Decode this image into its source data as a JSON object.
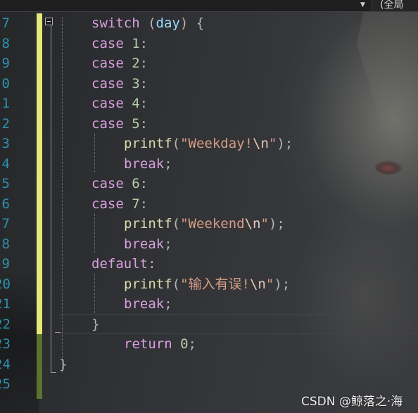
{
  "toolbar": {
    "scope_label": "(全局"
  },
  "editor": {
    "line_numbers": [
      "7",
      "8",
      "9",
      "0",
      "1",
      "2",
      "3",
      "4",
      "5",
      "6",
      "7",
      "8",
      "9",
      "20",
      "21",
      "22",
      "23",
      "24",
      "25"
    ],
    "lines": [
      [
        {
          "t": "switch",
          "c": "kw"
        },
        {
          "t": " (",
          "c": "punct"
        },
        {
          "t": "day",
          "c": "var"
        },
        {
          "t": ") {",
          "c": "punct"
        }
      ],
      [
        {
          "t": "case",
          "c": "kw"
        },
        {
          "t": " ",
          "c": "punct"
        },
        {
          "t": "1",
          "c": "num"
        },
        {
          "t": ":",
          "c": "punct"
        }
      ],
      [
        {
          "t": "case",
          "c": "kw"
        },
        {
          "t": " ",
          "c": "punct"
        },
        {
          "t": "2",
          "c": "num"
        },
        {
          "t": ":",
          "c": "punct"
        }
      ],
      [
        {
          "t": "case",
          "c": "kw"
        },
        {
          "t": " ",
          "c": "punct"
        },
        {
          "t": "3",
          "c": "num"
        },
        {
          "t": ":",
          "c": "punct"
        }
      ],
      [
        {
          "t": "case",
          "c": "kw"
        },
        {
          "t": " ",
          "c": "punct"
        },
        {
          "t": "4",
          "c": "num"
        },
        {
          "t": ":",
          "c": "punct"
        }
      ],
      [
        {
          "t": "case",
          "c": "kw"
        },
        {
          "t": " ",
          "c": "punct"
        },
        {
          "t": "5",
          "c": "num"
        },
        {
          "t": ":",
          "c": "punct"
        }
      ],
      [
        {
          "t": "printf",
          "c": "fn"
        },
        {
          "t": "(",
          "c": "punct"
        },
        {
          "t": "\"Weekday!",
          "c": "str"
        },
        {
          "t": "\\n",
          "c": "esc"
        },
        {
          "t": "\"",
          "c": "str"
        },
        {
          "t": ");",
          "c": "punct"
        }
      ],
      [
        {
          "t": "break",
          "c": "kw"
        },
        {
          "t": ";",
          "c": "punct"
        }
      ],
      [
        {
          "t": "case",
          "c": "kw"
        },
        {
          "t": " ",
          "c": "punct"
        },
        {
          "t": "6",
          "c": "num"
        },
        {
          "t": ":",
          "c": "punct"
        }
      ],
      [
        {
          "t": "case",
          "c": "kw"
        },
        {
          "t": " ",
          "c": "punct"
        },
        {
          "t": "7",
          "c": "num"
        },
        {
          "t": ":",
          "c": "punct"
        }
      ],
      [
        {
          "t": "printf",
          "c": "fn"
        },
        {
          "t": "(",
          "c": "punct"
        },
        {
          "t": "\"Weekend",
          "c": "str"
        },
        {
          "t": "\\n",
          "c": "esc"
        },
        {
          "t": "\"",
          "c": "str"
        },
        {
          "t": ");",
          "c": "punct"
        }
      ],
      [
        {
          "t": "break",
          "c": "kw"
        },
        {
          "t": ";",
          "c": "punct"
        }
      ],
      [
        {
          "t": "default",
          "c": "kw"
        },
        {
          "t": ":",
          "c": "punct"
        }
      ],
      [
        {
          "t": "printf",
          "c": "fn"
        },
        {
          "t": "(",
          "c": "punct"
        },
        {
          "t": "\"输入有误!",
          "c": "str"
        },
        {
          "t": "\\n",
          "c": "esc"
        },
        {
          "t": "\"",
          "c": "str"
        },
        {
          "t": ");",
          "c": "punct"
        }
      ],
      [
        {
          "t": "break",
          "c": "kw"
        },
        {
          "t": ";",
          "c": "punct"
        }
      ],
      [
        {
          "t": "}",
          "c": "punct"
        }
      ],
      [
        {
          "t": "return",
          "c": "kw"
        },
        {
          "t": " ",
          "c": "punct"
        },
        {
          "t": "0",
          "c": "num"
        },
        {
          "t": ";",
          "c": "punct"
        }
      ],
      [
        {
          "t": "}",
          "c": "punct"
        }
      ],
      []
    ],
    "colors": {
      "changed_unsaved": "#e6e87a",
      "changed_saved": "#577430"
    }
  },
  "watermark": {
    "text": "CSDN @鲸落之·海"
  }
}
